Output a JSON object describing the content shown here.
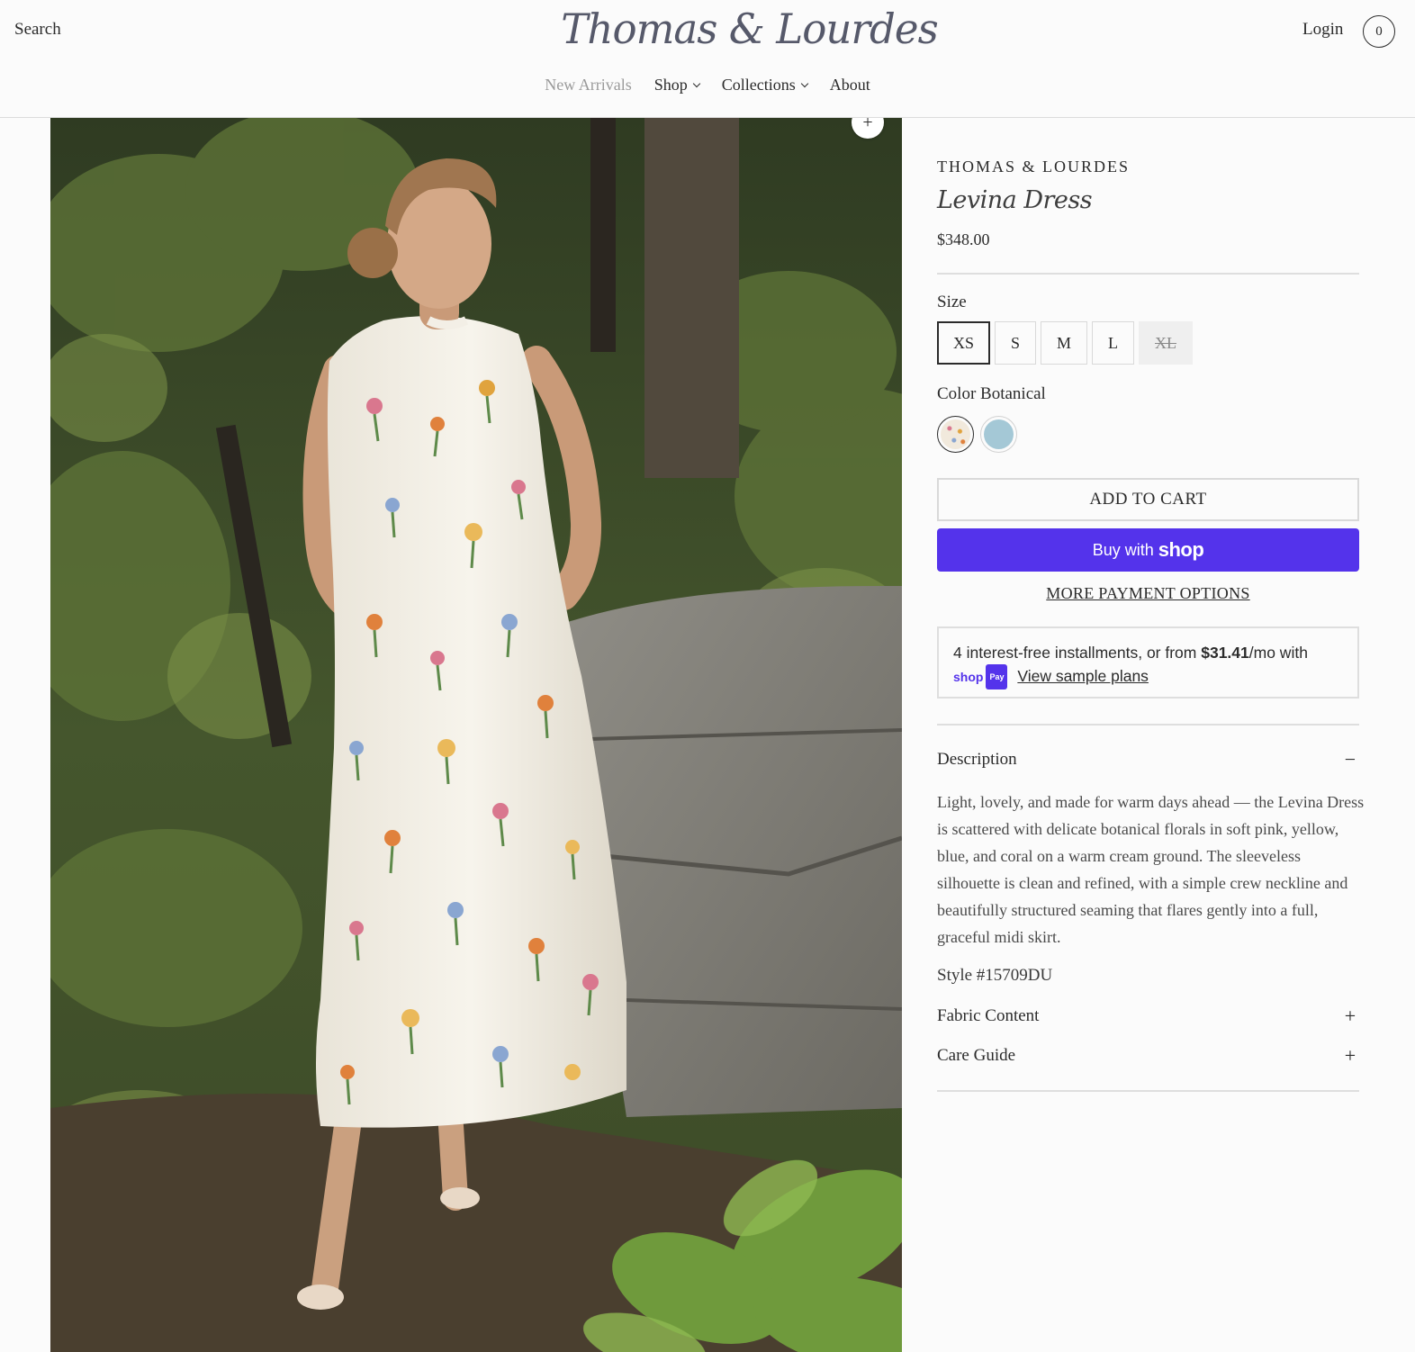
{
  "header": {
    "search_label": "Search",
    "logo_text": "Thomas & Lourdes",
    "login_label": "Login",
    "cart_count": "0",
    "nav": [
      {
        "label": "New Arrivals",
        "has_dropdown": false
      },
      {
        "label": "Shop",
        "has_dropdown": true
      },
      {
        "label": "Collections",
        "has_dropdown": true
      },
      {
        "label": "About",
        "has_dropdown": false
      }
    ]
  },
  "gallery": {
    "zoom_icon": "plus-icon",
    "zoom_label": "+"
  },
  "product": {
    "brand": "THOMAS & LOURDES",
    "title": "Levina Dress",
    "price": "$348.00",
    "size_label": "Size",
    "sizes": [
      {
        "label": "XS",
        "selected": true,
        "available": true
      },
      {
        "label": "S",
        "selected": false,
        "available": true
      },
      {
        "label": "M",
        "selected": false,
        "available": true
      },
      {
        "label": "L",
        "selected": false,
        "available": true
      },
      {
        "label": "XL",
        "selected": false,
        "available": false
      }
    ],
    "color_label": "Color",
    "color_value": "Botanical",
    "colors": [
      {
        "name": "Botanical",
        "selected": true,
        "hex": "#f1e9dc"
      },
      {
        "name": "Blue",
        "selected": false,
        "hex": "#a4c8d6"
      }
    ],
    "add_to_cart": "ADD TO CART",
    "buy_with_prefix": "Buy with",
    "buy_with_brand": "shop",
    "more_payment": "MORE PAYMENT OPTIONS",
    "installments": {
      "text_before": "4 interest-free installments, or from ",
      "amount": "$31.41",
      "text_after": "/mo with",
      "logo_text": "shop",
      "logo_badge": "Pay",
      "link": "View sample plans"
    },
    "description": {
      "heading": "Description",
      "toggle": "−",
      "body": "Light, lovely, and made for warm days ahead — the Levina Dress is scattered with delicate botanical florals in soft pink, yellow, blue, and coral on a warm cream ground. The sleeveless silhouette is clean and refined, with a simple crew neckline and beautifully structured seaming that flares gently into a full, graceful midi skirt.",
      "style": "Style #15709DU"
    },
    "accordions": [
      {
        "label": "Fabric Content",
        "toggle": "+"
      },
      {
        "label": "Care Guide",
        "toggle": "+"
      }
    ]
  },
  "colors": {
    "accent": "#5433eb",
    "text": "#2b2b2b",
    "border": "#d9d9d9"
  }
}
